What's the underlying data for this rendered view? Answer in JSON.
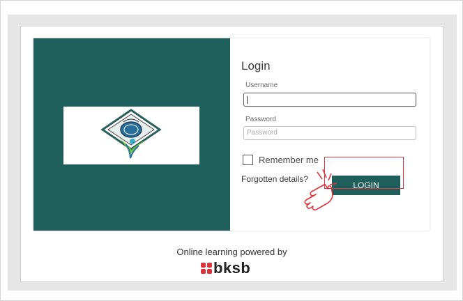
{
  "login": {
    "title": "Login",
    "username_label": "Username",
    "username_value": "",
    "password_label": "Password",
    "password_placeholder": "Password",
    "remember_label": "Remember me",
    "forgot_label": "Forgotten details?",
    "button_label": "LOGIN"
  },
  "footer": {
    "powered_by": "Online learning powered by",
    "brand": "bksb"
  },
  "colors": {
    "brand_teal": "#1f5f5b",
    "highlight_red": "#e0323a"
  },
  "icons": {
    "logo": "school-logo-icon",
    "cursor": "hand-pointer-icon",
    "bksb_mark": "bksb-logo-icon"
  }
}
